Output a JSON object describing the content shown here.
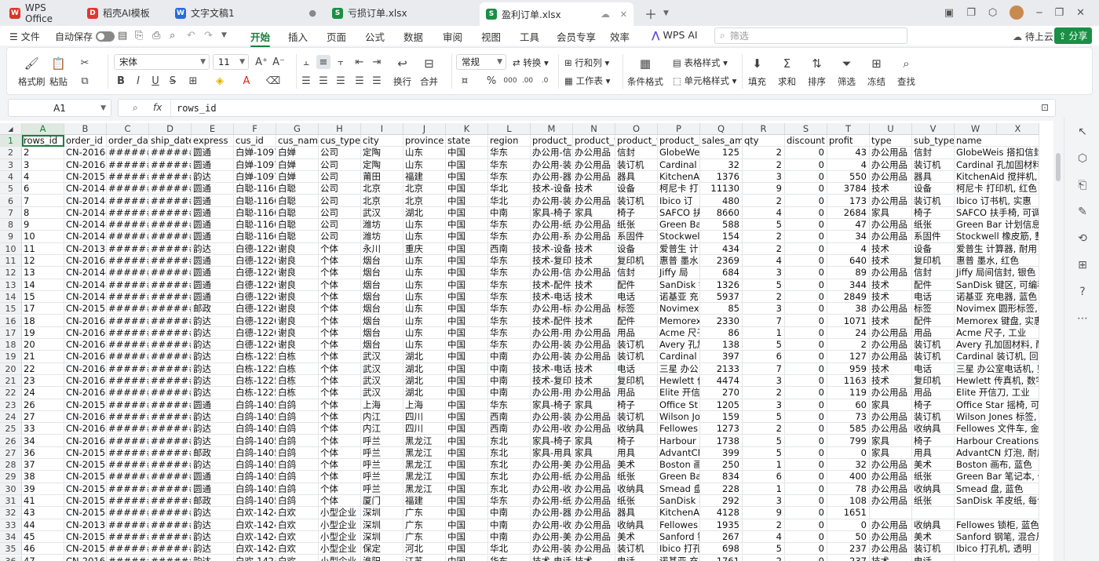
{
  "tabs": [
    {
      "label": "WPS Office",
      "icon": "wps-logo-icon",
      "color": "#d9362b",
      "glyph": "W",
      "active": false
    },
    {
      "label": "稻壳AI模板",
      "icon": "docer-icon",
      "color": "#e2362f",
      "glyph": "D",
      "active": false
    },
    {
      "label": "文字文稿1",
      "icon": "word-doc-icon",
      "color": "#2b6bd9",
      "glyph": "W",
      "active": false
    },
    {
      "label": "亏损订单.xlsx",
      "icon": "sheet-icon",
      "color": "#1a8f46",
      "glyph": "S",
      "active": false
    },
    {
      "label": "盈利订单.xlsx",
      "icon": "sheet-icon",
      "color": "#1a8f46",
      "glyph": "S",
      "active": true
    }
  ],
  "menu": {
    "file": "文件",
    "autosave": "自动保存",
    "tabs": [
      "开始",
      "插入",
      "页面",
      "公式",
      "数据",
      "审阅",
      "视图",
      "工具",
      "会员专享",
      "效率"
    ],
    "active_tab": "开始",
    "wps_ai": "WPS AI",
    "search_placeholder": "筛选",
    "cloud": "待上云",
    "share": "分享"
  },
  "ribbon": {
    "format_painter": "格式刷",
    "paste": "粘贴",
    "font_name": "宋体",
    "font_size": "11",
    "wrap": "换行",
    "merge": "合并",
    "number_format": "常规",
    "convert": "转换",
    "rows_cols": "行和列",
    "worksheet": "工作表",
    "cond_format": "条件格式",
    "table_style": "表格样式",
    "cell_style": "单元格样式",
    "fill": "填充",
    "sum": "求和",
    "sort": "排序",
    "filter": "筛选",
    "freeze": "冻结",
    "find": "查找"
  },
  "formula_bar": {
    "cell_ref": "A1",
    "fx": "fx",
    "content": "rows_id"
  },
  "sheet": {
    "columns": [
      "A",
      "B",
      "C",
      "D",
      "E",
      "F",
      "G",
      "H",
      "I",
      "J",
      "K",
      "L",
      "M",
      "N",
      "O",
      "P",
      "Q",
      "R",
      "S",
      "T",
      "U",
      "V",
      "W",
      "X"
    ],
    "numeric_columns": [
      "Q",
      "R",
      "S",
      "T"
    ],
    "row_numbers": [
      "1",
      "2",
      "3",
      "4",
      "5",
      "6",
      "7",
      "8",
      "9",
      "10",
      "11",
      "12",
      "13",
      "14",
      "15",
      "16",
      "17",
      "18",
      "19",
      "20",
      "21",
      "22",
      "23",
      "24",
      "25",
      "26",
      "27",
      "28",
      "29",
      "30",
      "31",
      "32",
      "33",
      "34",
      "35",
      "36"
    ],
    "rows": [
      [
        "rows_id",
        "order_id",
        "order_dat",
        "ship_date",
        "express",
        "cus_id",
        "cus_name",
        "cus_type",
        "city",
        "province",
        "state",
        "region",
        "product_i",
        "product_t",
        "product_t",
        "product_r",
        "sales_amt",
        "qty",
        "discount",
        "profit",
        "type",
        "sub_type",
        "name",
        ""
      ],
      [
        "2",
        "CN-2016-1",
        "########",
        "########",
        "圆通",
        "白婵-1097",
        "白婵",
        "公司",
        "定陶",
        "山东",
        "中国",
        "华东",
        "办公用-信",
        "办公用品",
        "信封",
        "GlobeWeis",
        "125",
        "2",
        "0",
        "43",
        "办公用品",
        "信封",
        "GlobeWeis 搭扣信封,",
        ""
      ],
      [
        "3",
        "CN-2016-1",
        "########",
        "########",
        "圆通",
        "白婵-1097",
        "白婵",
        "公司",
        "定陶",
        "山东",
        "中国",
        "华东",
        "办公用-装",
        "办公用品",
        "装订机",
        "Cardinal",
        "32",
        "2",
        "0",
        "4",
        "办公用品",
        "装订机",
        "Cardinal 孔加固材料,",
        ""
      ],
      [
        "4",
        "CN-2015-2",
        "########",
        "########",
        "韵达",
        "白婵-1097",
        "白婵",
        "公司",
        "莆田",
        "福建",
        "中国",
        "华东",
        "办公用-器",
        "办公用品",
        "器具",
        "KitchenAi",
        "1376",
        "3",
        "0",
        "550",
        "办公用品",
        "器具",
        "KitchenAid 搅拌机,",
        ""
      ],
      [
        "6",
        "CN-2014-4",
        "########",
        "########",
        "圆通",
        "白聪-1166",
        "白聪",
        "公司",
        "北京",
        "北京",
        "中国",
        "华北",
        "技术-设备",
        "技术",
        "设备",
        "柯尼卡 打",
        "11130",
        "9",
        "0",
        "3784",
        "技术",
        "设备",
        "柯尼卡 打印机, 红色",
        ""
      ],
      [
        "7",
        "CN-2014-4",
        "########",
        "########",
        "圆通",
        "白聪-1166",
        "白聪",
        "公司",
        "北京",
        "北京",
        "中国",
        "华北",
        "办公用-装",
        "办公用品",
        "装订机",
        "Ibico 订",
        "480",
        "2",
        "0",
        "173",
        "办公用品",
        "装订机",
        "Ibico 订书机, 实惠",
        ""
      ],
      [
        "8",
        "CN-2014-4",
        "########",
        "########",
        "圆通",
        "白聪-1166",
        "白聪",
        "公司",
        "武汉",
        "湖北",
        "中国",
        "中南",
        "家具-椅子",
        "家具",
        "椅子",
        "SAFCO 扶",
        "8660",
        "4",
        "0",
        "2684",
        "家具",
        "椅子",
        "SAFCO 扶手椅, 可调",
        ""
      ],
      [
        "9",
        "CN-2014-4",
        "########",
        "########",
        "圆通",
        "白聪-1166",
        "白聪",
        "公司",
        "潍坊",
        "山东",
        "中国",
        "华东",
        "办公用-纸",
        "办公用品",
        "纸张",
        "Green Bar",
        "588",
        "5",
        "0",
        "47",
        "办公用品",
        "纸张",
        "Green Bar 计划信息表",
        ""
      ],
      [
        "10",
        "CN-2014-4",
        "########",
        "########",
        "圆通",
        "白聪-1166",
        "白聪",
        "公司",
        "潍坊",
        "山东",
        "中国",
        "华东",
        "办公用-系",
        "办公用品",
        "系固件",
        "Stockwell",
        "154",
        "2",
        "0",
        "34",
        "办公用品",
        "系固件",
        "Stockwell 橡皮筋, 整",
        ""
      ],
      [
        "11",
        "CN-2013-4",
        "########",
        "########",
        "韵达",
        "白德-1220",
        "谢良",
        "个体",
        "永川",
        "重庆",
        "中国",
        "西南",
        "技术-设备",
        "技术",
        "设备",
        "爱普生 计",
        "434",
        "2",
        "0",
        "4",
        "技术",
        "设备",
        "爱普生 计算器, 耐用",
        ""
      ],
      [
        "12",
        "CN-2016-5",
        "########",
        "########",
        "圆通",
        "白德-1220",
        "谢良",
        "个体",
        "烟台",
        "山东",
        "中国",
        "华东",
        "技术-复印",
        "技术",
        "复印机",
        "惠普 墨水",
        "2369",
        "4",
        "0",
        "640",
        "技术",
        "复印机",
        "惠普 墨水, 红色",
        ""
      ],
      [
        "13",
        "CN-2014-2",
        "########",
        "########",
        "圆通",
        "白德-1220",
        "谢良",
        "个体",
        "烟台",
        "山东",
        "中国",
        "华东",
        "办公用-信",
        "办公用品",
        "信封",
        "Jiffy 局",
        "684",
        "3",
        "0",
        "89",
        "办公用品",
        "信封",
        "Jiffy 局间信封, 银色",
        ""
      ],
      [
        "14",
        "CN-2014-2",
        "########",
        "########",
        "圆通",
        "白德-1220",
        "谢良",
        "个体",
        "烟台",
        "山东",
        "中国",
        "华东",
        "技术-配件",
        "技术",
        "配件",
        "SanDisk 键",
        "1326",
        "5",
        "0",
        "344",
        "技术",
        "配件",
        "SanDisk 键区, 可编程",
        ""
      ],
      [
        "15",
        "CN-2014-2",
        "########",
        "########",
        "圆通",
        "白德-1220",
        "谢良",
        "个体",
        "烟台",
        "山东",
        "中国",
        "华东",
        "技术-电话",
        "技术",
        "电话",
        "诺基亚 充",
        "5937",
        "2",
        "0",
        "2849",
        "技术",
        "电话",
        "诺基亚 充电器, 蓝色",
        ""
      ],
      [
        "17",
        "CN-2015-2",
        "########",
        "########",
        "邮政",
        "白德-1220",
        "谢良",
        "个体",
        "烟台",
        "山东",
        "中国",
        "华东",
        "办公用-标",
        "办公用品",
        "标签",
        "Novimex 圆",
        "85",
        "3",
        "0",
        "38",
        "办公用品",
        "标签",
        "Novimex 圆形标签, 红",
        ""
      ],
      [
        "18",
        "CN-2016-5",
        "########",
        "########",
        "韵达",
        "白德-1220",
        "谢良",
        "个体",
        "烟台",
        "山东",
        "中国",
        "华东",
        "技术-配件",
        "技术",
        "配件",
        "Memorex 键",
        "2330",
        "7",
        "0",
        "1071",
        "技术",
        "配件",
        "Memorex 键盘, 实惠",
        ""
      ],
      [
        "19",
        "CN-2016-5",
        "########",
        "########",
        "韵达",
        "白德-1220",
        "谢良",
        "个体",
        "烟台",
        "山东",
        "中国",
        "华东",
        "办公用-用",
        "办公用品",
        "用品",
        "Acme 尺子",
        "86",
        "1",
        "0",
        "24",
        "办公用品",
        "用品",
        "Acme 尺子, 工业",
        ""
      ],
      [
        "20",
        "CN-2016-5",
        "########",
        "########",
        "韵达",
        "白德-1220",
        "谢良",
        "个体",
        "烟台",
        "山东",
        "中国",
        "华东",
        "办公用-装",
        "办公用品",
        "装订机",
        "Avery 孔加",
        "138",
        "5",
        "0",
        "2",
        "办公用品",
        "装订机",
        "Avery 孔加固材料, 耐",
        ""
      ],
      [
        "21",
        "CN-2016-5",
        "########",
        "########",
        "韵达",
        "白栋-1225",
        "白栋",
        "个体",
        "武汉",
        "湖北",
        "中国",
        "中南",
        "办公用-装",
        "办公用品",
        "装订机",
        "Cardinal",
        "397",
        "6",
        "0",
        "127",
        "办公用品",
        "装订机",
        "Cardinal 装订机, 回收",
        ""
      ],
      [
        "22",
        "CN-2016-5",
        "########",
        "########",
        "韵达",
        "白栋-1225",
        "白栋",
        "个体",
        "武汉",
        "湖北",
        "中国",
        "中南",
        "技术-电话",
        "技术",
        "电话",
        "三星 办公",
        "2133",
        "7",
        "0",
        "959",
        "技术",
        "电话",
        "三星 办公室电话机, 整",
        ""
      ],
      [
        "23",
        "CN-2016-5",
        "########",
        "########",
        "韵达",
        "白栋-1225",
        "白栋",
        "个体",
        "武汉",
        "湖北",
        "中国",
        "中南",
        "技术-复印",
        "技术",
        "复印机",
        "Hewlett 传",
        "4474",
        "3",
        "0",
        "1163",
        "技术",
        "复印机",
        "Hewlett 传真机, 数字",
        ""
      ],
      [
        "24",
        "CN-2016-5",
        "########",
        "########",
        "韵达",
        "白栋-1225",
        "白栋",
        "个体",
        "武汉",
        "湖北",
        "中国",
        "中南",
        "办公用-用",
        "办公用品",
        "用品",
        "Elite 开信",
        "270",
        "2",
        "0",
        "119",
        "办公用品",
        "用品",
        "Elite 开信刀, 工业",
        ""
      ],
      [
        "26",
        "CN-2015-4",
        "########",
        "########",
        "圆通",
        "白鸽-1405",
        "白鸽",
        "个体",
        "上海",
        "上海",
        "中国",
        "华东",
        "家具-椅子",
        "家具",
        "椅子",
        "Office St",
        "1205",
        "3",
        "0",
        "60",
        "家具",
        "椅子",
        "Office Star 摇椅, 可",
        ""
      ],
      [
        "27",
        "CN-2016-4",
        "########",
        "########",
        "韵达",
        "白鸽-1405",
        "白鸽",
        "个体",
        "内江",
        "四川",
        "中国",
        "西南",
        "办公用-装",
        "办公用品",
        "装订机",
        "Wilson Jo",
        "159",
        "5",
        "0",
        "73",
        "办公用品",
        "装订机",
        "Wilson Jones 标签, 回",
        ""
      ],
      [
        "33",
        "CN-2016-3",
        "########",
        "########",
        "韵达",
        "白鸽-1405",
        "白鸽",
        "个体",
        "内江",
        "四川",
        "中国",
        "西南",
        "办公用-收",
        "办公用品",
        "收纳具",
        "Fellowes ",
        "1273",
        "2",
        "0",
        "585",
        "办公用品",
        "收纳具",
        "Fellowes 文件车, 金属",
        ""
      ],
      [
        "34",
        "CN-2016-3",
        "########",
        "########",
        "韵达",
        "白鸽-1405",
        "白鸽",
        "个体",
        "呼兰",
        "黑龙江",
        "中国",
        "东北",
        "家具-椅子",
        "家具",
        "椅子",
        "Harbour C",
        "1738",
        "5",
        "0",
        "799",
        "家具",
        "椅子",
        "Harbour Creations 椅",
        ""
      ],
      [
        "36",
        "CN-2015-1",
        "########",
        "########",
        "邮政",
        "白鸽-1405",
        "白鸽",
        "个体",
        "呼兰",
        "黑龙江",
        "中国",
        "东北",
        "家具-用具",
        "家具",
        "用具",
        "AdvantCN ",
        "399",
        "5",
        "0",
        "0",
        "家具",
        "用具",
        "AdvantCN 灯泡, 耐用",
        ""
      ],
      [
        "37",
        "CN-2015-3",
        "########",
        "########",
        "韵达",
        "白鸽-1405",
        "白鸽",
        "个体",
        "呼兰",
        "黑龙江",
        "中国",
        "东北",
        "办公用-美",
        "办公用品",
        "美术",
        "Boston 画",
        "250",
        "1",
        "0",
        "32",
        "办公用品",
        "美术",
        "Boston 画布, 蓝色",
        ""
      ],
      [
        "38",
        "CN-2015-4",
        "########",
        "########",
        "圆通",
        "白鸽-1405",
        "白鸽",
        "个体",
        "呼兰",
        "黑龙江",
        "中国",
        "东北",
        "办公用-纸",
        "办公用品",
        "纸张",
        "Green Bar",
        "834",
        "6",
        "0",
        "400",
        "办公用品",
        "纸张",
        "Green Bar 笔记本, 优",
        ""
      ],
      [
        "39",
        "CN-2015-4",
        "########",
        "########",
        "圆通",
        "白鸽-1405",
        "白鸽",
        "个体",
        "呼兰",
        "黑龙江",
        "中国",
        "东北",
        "办公用-收",
        "办公用品",
        "收纳具",
        "Smead 盘,",
        "228",
        "1",
        "0",
        "78",
        "办公用品",
        "收纳具",
        "Smead 盘, 蓝色",
        ""
      ],
      [
        "41",
        "CN-2015-4",
        "########",
        "########",
        "邮政",
        "白鸽-1405",
        "白鸽",
        "个体",
        "厦门",
        "福建",
        "中国",
        "华东",
        "办公用-纸",
        "办公用品",
        "纸张",
        "SanDisk 羊",
        "292",
        "3",
        "0",
        "108",
        "办公用品",
        "纸张",
        "SanDisk 羊皮纸, 每包",
        ""
      ],
      [
        "43",
        "CN-2015-4",
        "########",
        "########",
        "韵达",
        "白欢-1424",
        "白欢",
        "小型企业",
        "深圳",
        "广东",
        "中国",
        "中南",
        "办公用-器",
        "办公用品",
        "器具",
        "KitchenAi",
        "4128",
        "9",
        "0",
        "1651",
        "",
        "",
        "",
        ""
      ],
      [
        "44",
        "CN-2013-2",
        "########",
        "########",
        "韵达",
        "白欢-1424",
        "白欢",
        "小型企业",
        "深圳",
        "广东",
        "中国",
        "中南",
        "办公用-收",
        "办公用品",
        "收纳具",
        "Fellowes ",
        "1935",
        "2",
        "0",
        "0",
        "办公用品",
        "收纳具",
        "Fellowes 锁柜, 蓝色",
        ""
      ],
      [
        "45",
        "CN-2015-2",
        "########",
        "########",
        "韵达",
        "白欢-1424",
        "白欢",
        "小型企业",
        "深圳",
        "广东",
        "中国",
        "中南",
        "办公用-美",
        "办公用品",
        "美术",
        "Sanford 钢",
        "267",
        "4",
        "0",
        "50",
        "办公用品",
        "美术",
        "Sanford 钢笔, 混合尺",
        ""
      ],
      [
        "46",
        "CN-2015-3",
        "########",
        "########",
        "韵达",
        "白欢-1424",
        "白欢",
        "小型企业",
        "保定",
        "河北",
        "中国",
        "华北",
        "办公用-装",
        "办公用品",
        "装订机",
        "Ibico 打孔",
        "698",
        "5",
        "0",
        "237",
        "办公用品",
        "装订机",
        "Ibico 打孔机, 透明",
        ""
      ],
      [
        "47",
        "CN-2016-1",
        "########",
        "########",
        "韵达",
        "白欢-1424",
        "白欢",
        "小型企业",
        "淮阳",
        "江苏",
        "中国",
        "华东",
        "技术-电话",
        "技术",
        "电话",
        "诺基亚 充",
        "1761",
        "2",
        "0",
        "237",
        "技术",
        "电话",
        "",
        ""
      ]
    ]
  },
  "colors": {
    "accent": "#1a7f3c",
    "share_bg": "#1a8f46"
  }
}
